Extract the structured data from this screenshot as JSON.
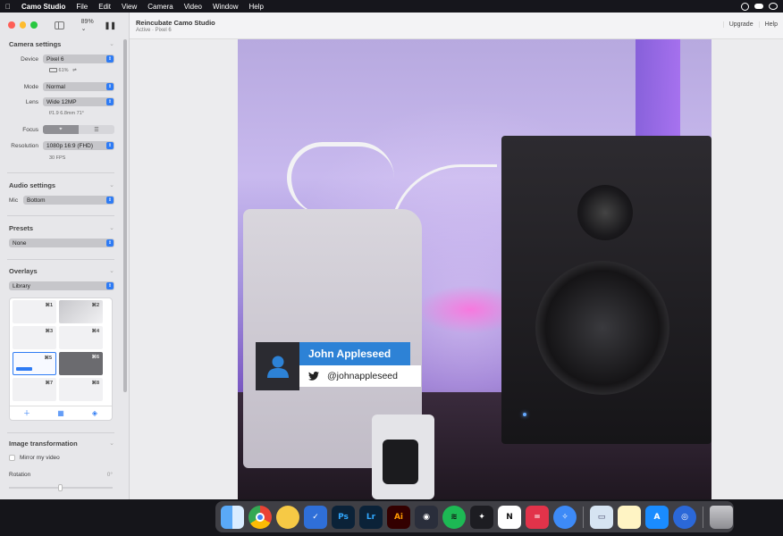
{
  "menubar": {
    "items": [
      "Camo Studio",
      "File",
      "Edit",
      "View",
      "Camera",
      "Video",
      "Window",
      "Help"
    ],
    "status_icons": [
      "camo-status-icon",
      "cloud-icon",
      "creative-cloud-icon"
    ]
  },
  "sidebar": {
    "zoom": "89% ⌄",
    "camera_settings": {
      "title": "Camera settings",
      "device_label": "Device",
      "device_value": "Pixel 6",
      "battery": "61%",
      "mode_label": "Mode",
      "mode_value": "Normal",
      "lens_label": "Lens",
      "lens_value": "Wide 12MP",
      "lens_info": "f/1.9 6.8mm 71°",
      "focus_label": "Focus",
      "resolution_label": "Resolution",
      "resolution_value": "1080p 16:9 (FHD)",
      "fps": "30 FPS"
    },
    "audio_settings": {
      "title": "Audio settings",
      "mic_label": "Mic",
      "mic_value": "Bottom"
    },
    "presets": {
      "title": "Presets",
      "value": "None"
    },
    "overlays": {
      "title": "Overlays",
      "library_value": "Library",
      "tiles": [
        "⌘1",
        "⌘2",
        "⌘3",
        "⌘4",
        "⌘5",
        "⌘6",
        "⌘7",
        "⌘8"
      ]
    },
    "image_transformation": {
      "title": "Image transformation",
      "mirror_label": "Mirror my video",
      "rotation_label": "Rotation",
      "rotation_value": "0°"
    }
  },
  "toolbar": {
    "title": "Reincubate Camo Studio",
    "subtitle": "Active · Pixel 6",
    "upgrade": "Upgrade",
    "help": "Help"
  },
  "overlay_card": {
    "name": "John Appleseed",
    "handle": "@johnappleseed"
  },
  "dock": {
    "apps": [
      "Finder",
      "Chrome",
      "Cyberduck",
      "Things",
      "Ps",
      "Lr",
      "Ai",
      "DaVinci Resolve",
      "Spotify",
      "Final Cut Pro",
      "Notion",
      "Toggl",
      "Safari",
      "Preview",
      "Notes",
      "App Store",
      "Camo",
      "Trash"
    ]
  }
}
